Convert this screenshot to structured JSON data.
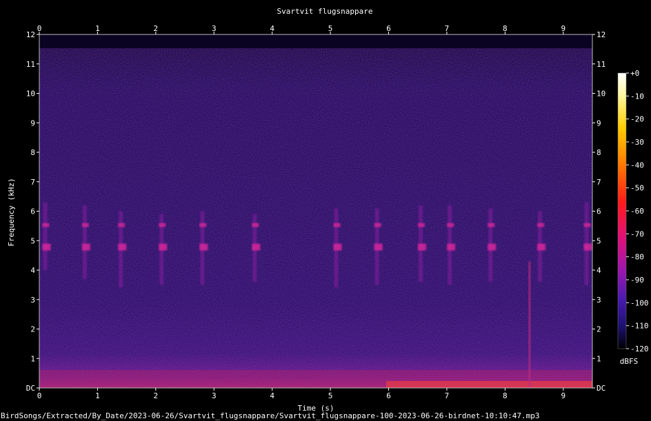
{
  "chart_data": {
    "type": "heatmap",
    "title": "Svartvit flugsnappare",
    "xlabel": "Time (s)",
    "ylabel": "Frequency (kHz)",
    "xlim": [
      0,
      9.5
    ],
    "ylim": [
      0,
      12
    ],
    "x_ticks": [
      "0",
      "1",
      "2",
      "3",
      "4",
      "5",
      "6",
      "7",
      "8",
      "9"
    ],
    "y_ticks": [
      "DC",
      "1",
      "2",
      "3",
      "4",
      "5",
      "6",
      "7",
      "8",
      "9",
      "10",
      "11",
      "12"
    ],
    "colorbar": {
      "label": "dBFS",
      "ticks": [
        "+0",
        "-10",
        "-20",
        "-30",
        "-40",
        "-50",
        "-60",
        "-70",
        "-80",
        "-90",
        "-100",
        "-110",
        "-120"
      ],
      "range": [
        -120,
        0
      ]
    },
    "calls": [
      {
        "t": 0.1,
        "f_low": 4.0,
        "f_high": 6.3
      },
      {
        "t": 0.78,
        "f_low": 3.7,
        "f_high": 6.2
      },
      {
        "t": 1.4,
        "f_low": 3.4,
        "f_high": 6.0
      },
      {
        "t": 2.1,
        "f_low": 3.5,
        "f_high": 5.9
      },
      {
        "t": 2.8,
        "f_low": 3.5,
        "f_high": 6.0
      },
      {
        "t": 3.7,
        "f_low": 3.6,
        "f_high": 5.9
      },
      {
        "t": 5.1,
        "f_low": 3.4,
        "f_high": 6.1
      },
      {
        "t": 5.8,
        "f_low": 3.5,
        "f_high": 6.1
      },
      {
        "t": 6.55,
        "f_low": 3.6,
        "f_high": 6.2
      },
      {
        "t": 7.05,
        "f_low": 3.5,
        "f_high": 6.2
      },
      {
        "t": 7.75,
        "f_low": 3.6,
        "f_high": 6.1
      },
      {
        "t": 8.6,
        "f_low": 3.6,
        "f_high": 6.0
      },
      {
        "t": 9.4,
        "f_low": 3.5,
        "f_high": 6.3
      }
    ],
    "grid": false,
    "legend": "right"
  },
  "footer": {
    "path": "BirdSongs/Extracted/By_Date/2023-06-26/Svartvit_flugsnappare/Svartvit_flugsnappare-100-2023-06-26-birdnet-10:10:47.mp3"
  },
  "colors": {
    "background": "#000000",
    "noise": "#2a0f66",
    "call": "#d0259a",
    "low_band": "#e23a4a"
  }
}
